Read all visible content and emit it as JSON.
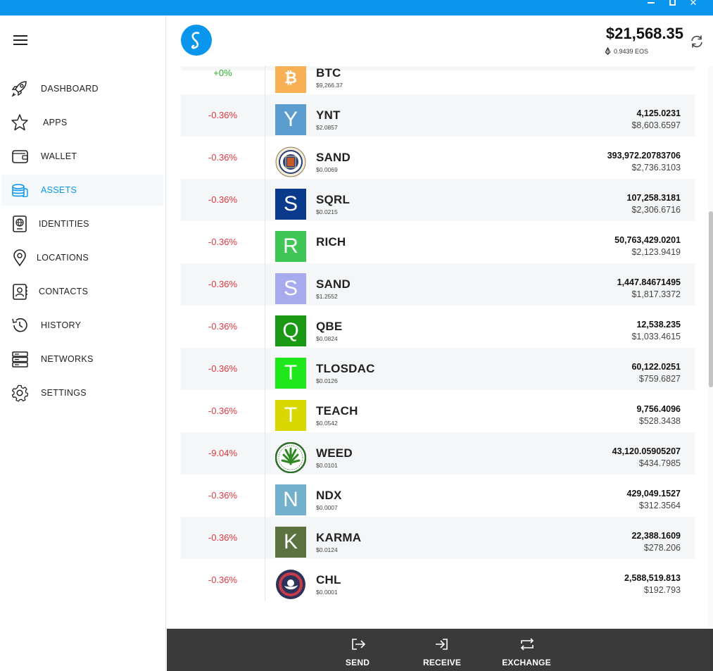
{
  "window": {
    "min_icon": "minimize-icon",
    "max_icon": "maximize-icon",
    "close_icon": "close-icon",
    "close_glyph": "✕"
  },
  "colors": {
    "accent": "#0b96ee",
    "positive": "#22b222",
    "negative": "#e0383e",
    "bottom_bar": "#3a3a3a"
  },
  "sidebar": {
    "items": [
      {
        "label": "DASHBOARD",
        "icon": "rocket-icon"
      },
      {
        "label": "APPS",
        "icon": "star-icon"
      },
      {
        "label": "WALLET",
        "icon": "wallet-icon"
      },
      {
        "label": "ASSETS",
        "icon": "coins-icon",
        "active": true
      },
      {
        "label": "IDENTITIES",
        "icon": "passport-icon"
      },
      {
        "label": "LOCATIONS",
        "icon": "location-pin-icon"
      },
      {
        "label": "CONTACTS",
        "icon": "contacts-icon"
      },
      {
        "label": "HISTORY",
        "icon": "history-icon"
      },
      {
        "label": "NETWORKS",
        "icon": "server-icon"
      },
      {
        "label": "SETTINGS",
        "icon": "gear-icon"
      }
    ]
  },
  "header": {
    "total": "$21,568.35",
    "eos_balance": "0.9439 EOS"
  },
  "tokens": [
    {
      "change": "+0%",
      "symbol": "BTC",
      "price": "$9,266.37",
      "amount": "",
      "value": "",
      "letter": "",
      "bg": "#f7b053"
    },
    {
      "change": "-0.36%",
      "symbol": "YNT",
      "price": "$2.0857",
      "amount": "4,125.0231",
      "value": "$8,603.6597",
      "letter": "Y",
      "bg": "#5b9dce"
    },
    {
      "change": "-0.36%",
      "symbol": "SAND",
      "price": "$0.0069",
      "amount": "393,972.20783706",
      "value": "$2,736.3103",
      "letter": "",
      "bg": "seal"
    },
    {
      "change": "-0.36%",
      "symbol": "SQRL",
      "price": "$0.0215",
      "amount": "107,258.3181",
      "value": "$2,306.6716",
      "letter": "S",
      "bg": "#0a3a8c"
    },
    {
      "change": "-0.36%",
      "symbol": "RICH",
      "price": "",
      "amount": "50,763,429.0201",
      "value": "$2,123.9419",
      "letter": "R",
      "bg": "#3ec755"
    },
    {
      "change": "-0.36%",
      "symbol": "SAND",
      "price": "$1.2552",
      "amount": "1,447.84671495",
      "value": "$1,817.3372",
      "letter": "S",
      "bg": "#a8aaee"
    },
    {
      "change": "-0.36%",
      "symbol": "QBE",
      "price": "$0.0824",
      "amount": "12,538.235",
      "value": "$1,033.4615",
      "letter": "Q",
      "bg": "#1a9a14"
    },
    {
      "change": "-0.36%",
      "symbol": "TLOSDAC",
      "price": "$0.0126",
      "amount": "60,122.0251",
      "value": "$759.6827",
      "letter": "T",
      "bg": "#1ee81a"
    },
    {
      "change": "-0.36%",
      "symbol": "TEACH",
      "price": "$0.0542",
      "amount": "9,756.4096",
      "value": "$528.3438",
      "letter": "T",
      "bg": "#d8d800"
    },
    {
      "change": "-9.04%",
      "symbol": "WEED",
      "price": "$0.0101",
      "amount": "43,120.05905207",
      "value": "$434.7985",
      "letter": "",
      "bg": "weed"
    },
    {
      "change": "-0.36%",
      "symbol": "NDX",
      "price": "$0.0007",
      "amount": "429,049.1527",
      "value": "$312.3564",
      "letter": "N",
      "bg": "#72b0cb"
    },
    {
      "change": "-0.36%",
      "symbol": "KARMA",
      "price": "$0.0124",
      "amount": "22,388.1609",
      "value": "$278.206",
      "letter": "K",
      "bg": "#5c7240"
    },
    {
      "change": "-0.36%",
      "symbol": "CHL",
      "price": "$0.0001",
      "amount": "2,588,519.813",
      "value": "$192.793",
      "letter": "",
      "bg": "chl"
    }
  ],
  "actions": [
    {
      "label": "SEND",
      "icon": "send-icon"
    },
    {
      "label": "RECEIVE",
      "icon": "receive-icon"
    },
    {
      "label": "EXCHANGE",
      "icon": "exchange-icon"
    }
  ]
}
